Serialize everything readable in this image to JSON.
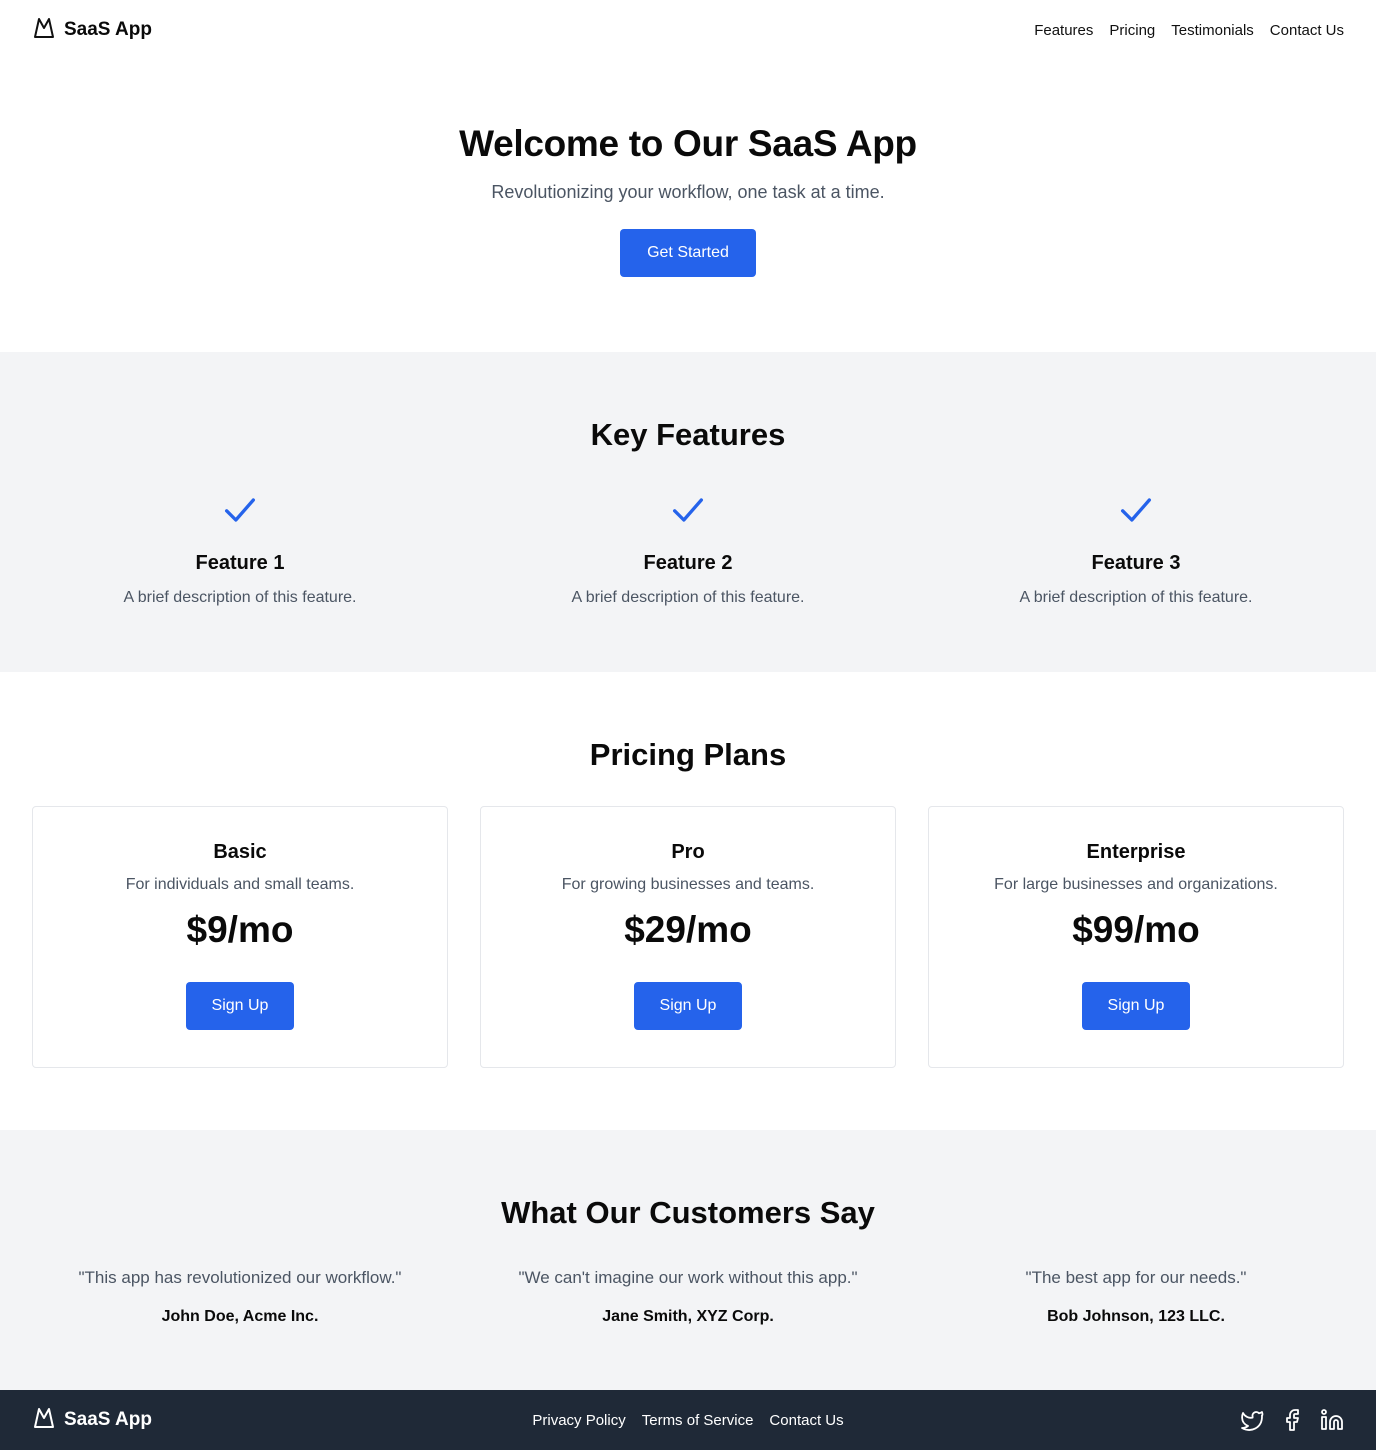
{
  "brand": {
    "name": "SaaS App",
    "icon": "mountain-icon"
  },
  "nav": {
    "items": [
      "Features",
      "Pricing",
      "Testimonials",
      "Contact Us"
    ]
  },
  "hero": {
    "title": "Welcome to Our SaaS App",
    "subtitle": "Revolutionizing your workflow, one task at a time.",
    "cta": "Get Started"
  },
  "features": {
    "title": "Key Features",
    "icon": "check-icon",
    "items": [
      {
        "name": "Feature 1",
        "description": "A brief description of this feature."
      },
      {
        "name": "Feature 2",
        "description": "A brief description of this feature."
      },
      {
        "name": "Feature 3",
        "description": "A brief description of this feature."
      }
    ]
  },
  "pricing": {
    "title": "Pricing Plans",
    "plans": [
      {
        "name": "Basic",
        "description": "For individuals and small teams.",
        "price": "$9/mo",
        "cta": "Sign Up"
      },
      {
        "name": "Pro",
        "description": "For growing businesses and teams.",
        "price": "$29/mo",
        "cta": "Sign Up"
      },
      {
        "name": "Enterprise",
        "description": "For large businesses and organizations.",
        "price": "$99/mo",
        "cta": "Sign Up"
      }
    ]
  },
  "testimonials": {
    "title": "What Our Customers Say",
    "items": [
      {
        "quote": "\"This app has revolutionized our workflow.\"",
        "author": "John Doe, Acme Inc."
      },
      {
        "quote": "\"We can't imagine our work without this app.\"",
        "author": "Jane Smith, XYZ Corp."
      },
      {
        "quote": "\"The best app for our needs.\"",
        "author": "Bob Johnson, 123 LLC."
      }
    ]
  },
  "footer": {
    "links": [
      "Privacy Policy",
      "Terms of Service",
      "Contact Us"
    ],
    "social": [
      "twitter-icon",
      "facebook-icon",
      "linkedin-icon"
    ]
  },
  "colors": {
    "accent": "#2563eb",
    "section_bg": "#f3f4f6",
    "footer_bg": "#1f2937",
    "muted_text": "#4b5563"
  }
}
